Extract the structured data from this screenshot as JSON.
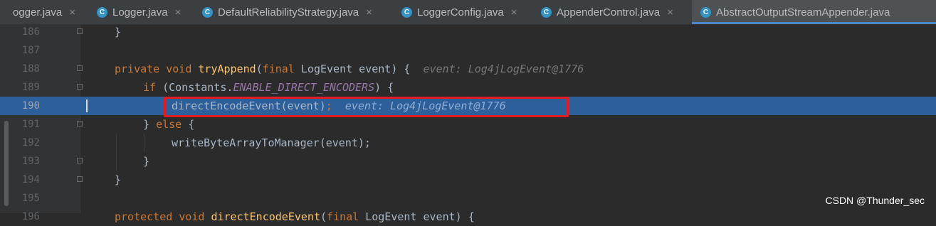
{
  "tabs": [
    {
      "label": "ogger.java",
      "close": "×",
      "icon": "",
      "active": false
    },
    {
      "label": "Logger.java",
      "close": "×",
      "icon": "C",
      "active": false
    },
    {
      "label": "DefaultReliabilityStrategy.java",
      "close": "×",
      "icon": "C",
      "active": false
    },
    {
      "label": "LoggerConfig.java",
      "close": "×",
      "icon": "C",
      "active": false
    },
    {
      "label": "AppenderControl.java",
      "close": "×",
      "icon": "C",
      "active": false
    },
    {
      "label": "AbstractOutputStreamAppender.java",
      "close": "×",
      "icon": "C",
      "active": true
    }
  ],
  "editor": {
    "current_line": "190",
    "lines": [
      {
        "num": "186",
        "t1": "}"
      },
      {
        "num": "187"
      },
      {
        "num": "188",
        "kw1": "private void ",
        "fn": "tryAppend",
        "t1": "(",
        "kw2": "final ",
        "t2": "LogEvent event) {",
        "hint": "event: Log4jLogEvent@1776"
      },
      {
        "num": "189",
        "kw1": "if ",
        "t1": "(Constants.",
        "const": "ENABLE_DIRECT_ENCODERS",
        "t2": ") {"
      },
      {
        "num": "190",
        "t1": "directEncodeEvent(event)",
        "semi": ";",
        "hint": "event: Log4jLogEvent@1776"
      },
      {
        "num": "191",
        "t1": "} ",
        "kw1": "else",
        "t2": " {"
      },
      {
        "num": "192",
        "t1": "writeByteArrayToManager(event);"
      },
      {
        "num": "193",
        "t1": "}"
      },
      {
        "num": "194",
        "t1": "}"
      },
      {
        "num": "195"
      },
      {
        "num": "196",
        "kw1": "protected void ",
        "fn": "directEncodeEvent",
        "t1": "(",
        "kw2": "final ",
        "t2": "LogEvent event) {"
      }
    ]
  },
  "watermark": "CSDN @Thunder_sec",
  "colors": {
    "background": "#2b2b2b",
    "gutter": "#313335",
    "keyword": "#cc7832",
    "function": "#ffc66d",
    "constant": "#9876aa",
    "current_line_highlight": "#2d5f9a",
    "annotation_box": "#e31b23"
  }
}
